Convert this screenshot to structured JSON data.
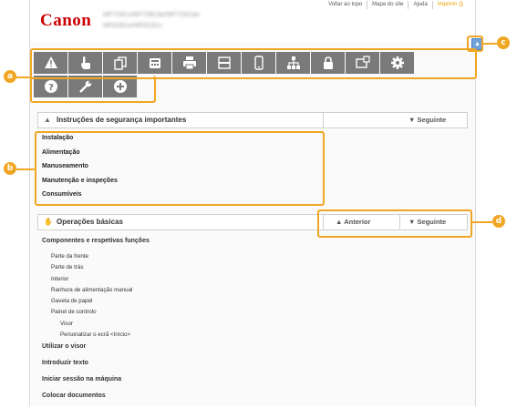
{
  "header": {
    "logo": "Canon",
    "model_line1": "MF729Cx/MF728Cdw/MF724Cdw",
    "model_line2": "MF628Cw/MF623Cn",
    "links": [
      "Voltar ao topo",
      "Mapa do site",
      "Ajuda",
      "Imprimir"
    ]
  },
  "toolbar": {
    "row1": [
      "warning-icon",
      "touch-hand-icon",
      "copy-icon",
      "fax-icon",
      "printer-icon",
      "scanner-icon",
      "mobile-icon",
      "network-icon",
      "lock-icon",
      "remote-ui-icon",
      "gear-icon"
    ],
    "row2": [
      "help-icon",
      "wrench-icon",
      "plus-icon"
    ]
  },
  "section1": {
    "title": "Instruções de segurança importantes",
    "next": "Seguinte",
    "items": [
      "Instalação",
      "Alimentação",
      "Manuseamento",
      "Manutenção e inspeções",
      "Consumíveis"
    ]
  },
  "section2": {
    "title": "Operações básicas",
    "prev": "Anterior",
    "next": "Seguinte",
    "tree": [
      {
        "text": "Componentes e respetivas funções",
        "level": 0
      },
      {
        "text": "Parte da frente",
        "level": 1
      },
      {
        "text": "Parte de trás",
        "level": 1
      },
      {
        "text": "Interior",
        "level": 1
      },
      {
        "text": "Ranhura de alimentação manual",
        "level": 1
      },
      {
        "text": "Gaveta de papel",
        "level": 1
      },
      {
        "text": "Painel de controlo",
        "level": 1
      },
      {
        "text": "Visor",
        "level": 2
      },
      {
        "text": "Personalizar o ecrã <Início>",
        "level": 2
      },
      {
        "text": "Utilizar o visor",
        "level": 0
      },
      {
        "text": "Introduzir texto",
        "level": 0
      },
      {
        "text": "Iniciar sessão na máquina",
        "level": 0
      },
      {
        "text": "Colocar documentos",
        "level": 0
      }
    ]
  },
  "callouts": [
    "a",
    "b",
    "c",
    "d"
  ],
  "colors": {
    "accent": "#f0a623",
    "brand": "#cc0000",
    "toolbar": "#7a7a7a"
  }
}
